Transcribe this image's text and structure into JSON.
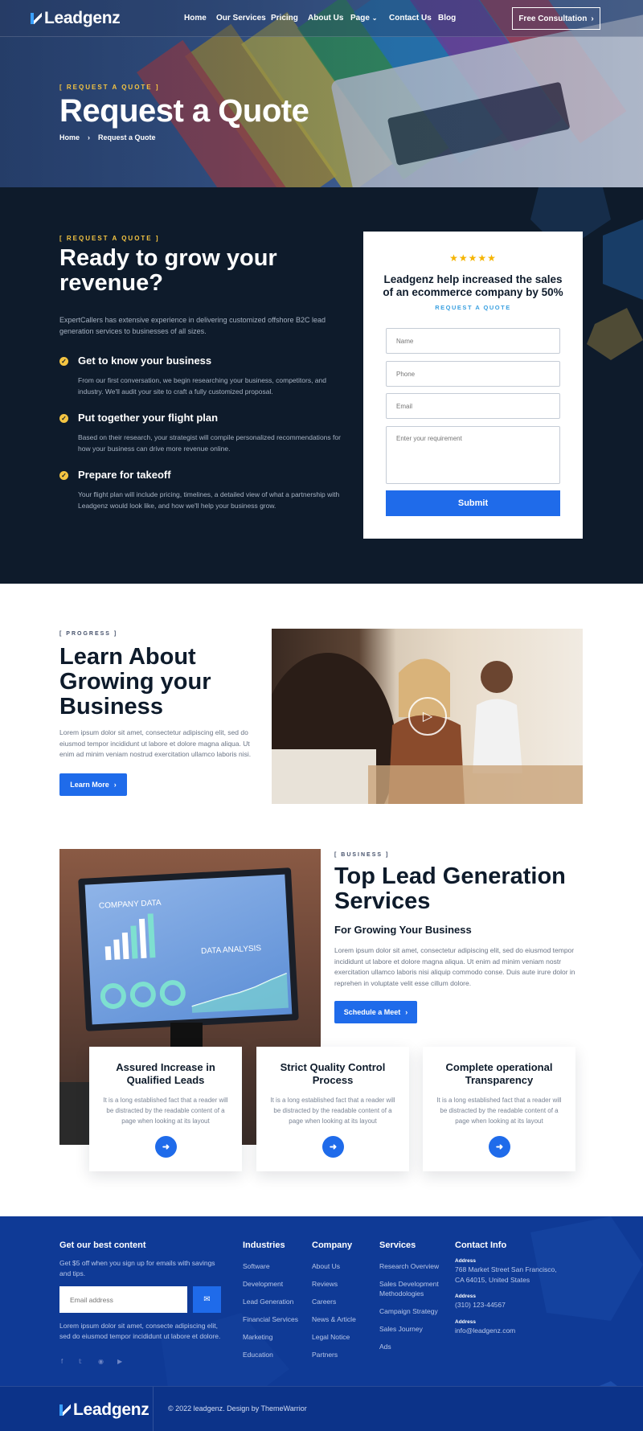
{
  "brand": {
    "name": "Leadgenz"
  },
  "nav": {
    "items": [
      "Home",
      "Our Services",
      "Pricing",
      "About Us",
      "Page",
      "Contact Us",
      "Blog"
    ],
    "cta": "Free Consultation"
  },
  "hero": {
    "eyebrow": "[ REQUEST A QUOTE ]",
    "title": "Request a Quote",
    "breadcrumb": [
      "Home",
      "Request a Quote"
    ]
  },
  "grow": {
    "eyebrow": "[ REQUEST A QUOTE ]",
    "title": "Ready to grow your revenue?",
    "lead": "ExpertCallers has extensive experience in delivering customized offshore B2C lead generation services to businesses of all sizes.",
    "steps": [
      {
        "title": "Get to know your business",
        "text": "From our first conversation, we begin researching your business, competitors, and industry. We'll audit your site to craft a fully customized proposal."
      },
      {
        "title": "Put together your flight plan",
        "text": "Based on their research, your strategist will compile personalized recommendations for how your business can drive more revenue online."
      },
      {
        "title": "Prepare for takeoff",
        "text": "Your flight plan will include pricing, timelines, a detailed view of what a partnership with Leadgenz would look like, and how we'll help your business grow."
      }
    ]
  },
  "form": {
    "stars": "★★★★★",
    "rating": 5,
    "headline": "Leadgenz help increased the sales of an ecommerce company by 50%",
    "sub": "REQUEST A QUOTE",
    "name_placeholder": "Name",
    "phone_placeholder": "Phone",
    "email_placeholder": "Email",
    "req_placeholder": "Enter your requirement",
    "submit": "Submit"
  },
  "learn": {
    "eyebrow": "[ PROGRESS ]",
    "title": "Learn About Growing your Business",
    "text": "Lorem ipsum dolor sit amet, consectetur adipiscing elit, sed do eiusmod tempor incididunt ut labore et dolore magna aliqua. Ut enim ad minim veniam nostrud exercitation ullamco laboris nisi.",
    "button": "Learn More"
  },
  "services": {
    "eyebrow": "[ BUSINESS ]",
    "title": "Top Lead Generation Services",
    "subtitle": "For Growing Your Business",
    "text": "Lorem ipsum dolor sit amet, consectetur adipiscing elit, sed do eiusmod tempor incididunt ut labore et dolore magna aliqua. Ut enim ad minim veniam nostr exercitation ullamco laboris nisi aliquip commodo conse. Duis aute irure dolor in reprehen in voluptate velit esse cillum dolore.",
    "button": "Schedule a Meet",
    "screen_title": "COMPANY DATA",
    "screen_sub": "DATA ANALYSIS",
    "cards": [
      {
        "title": "Assured Increase in Qualified Leads",
        "text": "It is a long established fact that a reader will be distracted by the readable content of a page when looking at its layout"
      },
      {
        "title": "Strict Quality Control Process",
        "text": "It is a long established fact that a reader will be distracted by the readable content of a page when looking at its layout"
      },
      {
        "title": "Complete operational Transparency",
        "text": "It is a long established fact that a reader will be distracted by the readable content of a page when looking at its layout"
      }
    ]
  },
  "footer": {
    "newsletter_title": "Get our best content",
    "newsletter_text": "Get $5 off when you sign up for emails with savings and tips.",
    "email_placeholder": "Email address",
    "about_text": "Lorem ipsum dolor sit amet, consecte adipiscing elit, sed do eiusmod tempor incididunt ut labore et dolore.",
    "industries": {
      "title": "Industries",
      "links": [
        "Software",
        "Development",
        "Lead Generation",
        "Financial Services",
        "Marketing",
        "Education"
      ]
    },
    "company": {
      "title": "Company",
      "links": [
        "About Us",
        "Reviews",
        "Careers",
        "News & Article",
        "Legal Notice",
        "Partners"
      ]
    },
    "services": {
      "title": "Services",
      "links": [
        "Research Overview",
        "Sales Development Methodologies",
        "Campaign Strategy",
        "Sales Journey",
        "Ads"
      ]
    },
    "contact": {
      "title": "Contact Info",
      "address_label": "Address",
      "address": "768 Market Street San Francisco, CA 64015, United States",
      "phone_label": "Address",
      "phone": "(310) 123-44567",
      "email_label": "Address",
      "email": "info@leadgenz.com"
    },
    "copyright": "© 2022 leadgenz. Design by ThemeWarrior"
  }
}
